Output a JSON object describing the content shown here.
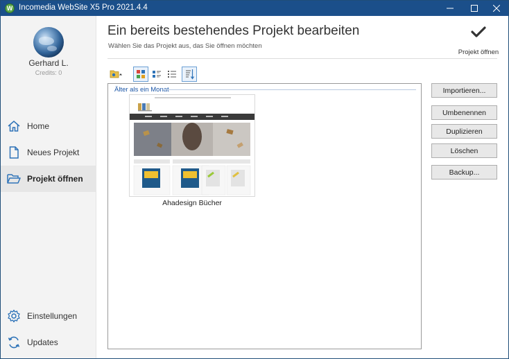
{
  "window": {
    "title": "Incomedia WebSite X5 Pro 2021.4.4",
    "logo_letter": "W",
    "controls": [
      "minimize-icon",
      "maximize-icon",
      "close-icon"
    ]
  },
  "sidebar": {
    "user_name": "Gerhard L.",
    "credits": "Credits: 0",
    "items": [
      {
        "label": "Home",
        "icon": "home-icon"
      },
      {
        "label": "Neues Projekt",
        "icon": "new-document-icon"
      },
      {
        "label": "Projekt öffnen",
        "icon": "open-folder-icon",
        "active": true
      },
      {
        "label": "Einstellungen",
        "icon": "gear-icon"
      },
      {
        "label": "Updates",
        "icon": "refresh-icon"
      }
    ]
  },
  "header": {
    "title": "Ein bereits bestehendes Projekt bearbeiten",
    "subtitle": "Wählen Sie das Projekt aus, das Sie öffnen möchten",
    "open_label": "Projekt öffnen"
  },
  "toolbar": {
    "buttons": [
      "new-folder-icon",
      "large-thumbnails-icon",
      "details-view-icon",
      "list-view-icon",
      "sort-icon"
    ]
  },
  "projects": {
    "group_label": "Älter als ein Monat",
    "items": [
      {
        "name": "Ahadesign Bücher"
      }
    ]
  },
  "actions": {
    "import": "Importieren...",
    "rename": "Umbenennen",
    "duplicate": "Duplizieren",
    "delete": "Löschen",
    "backup": "Backup..."
  },
  "colors": {
    "titlebar": "#1b4f8a",
    "accent": "#1a55a6",
    "sidebar_bg": "#f3f3f3",
    "active_item": "#e6e6e6"
  }
}
